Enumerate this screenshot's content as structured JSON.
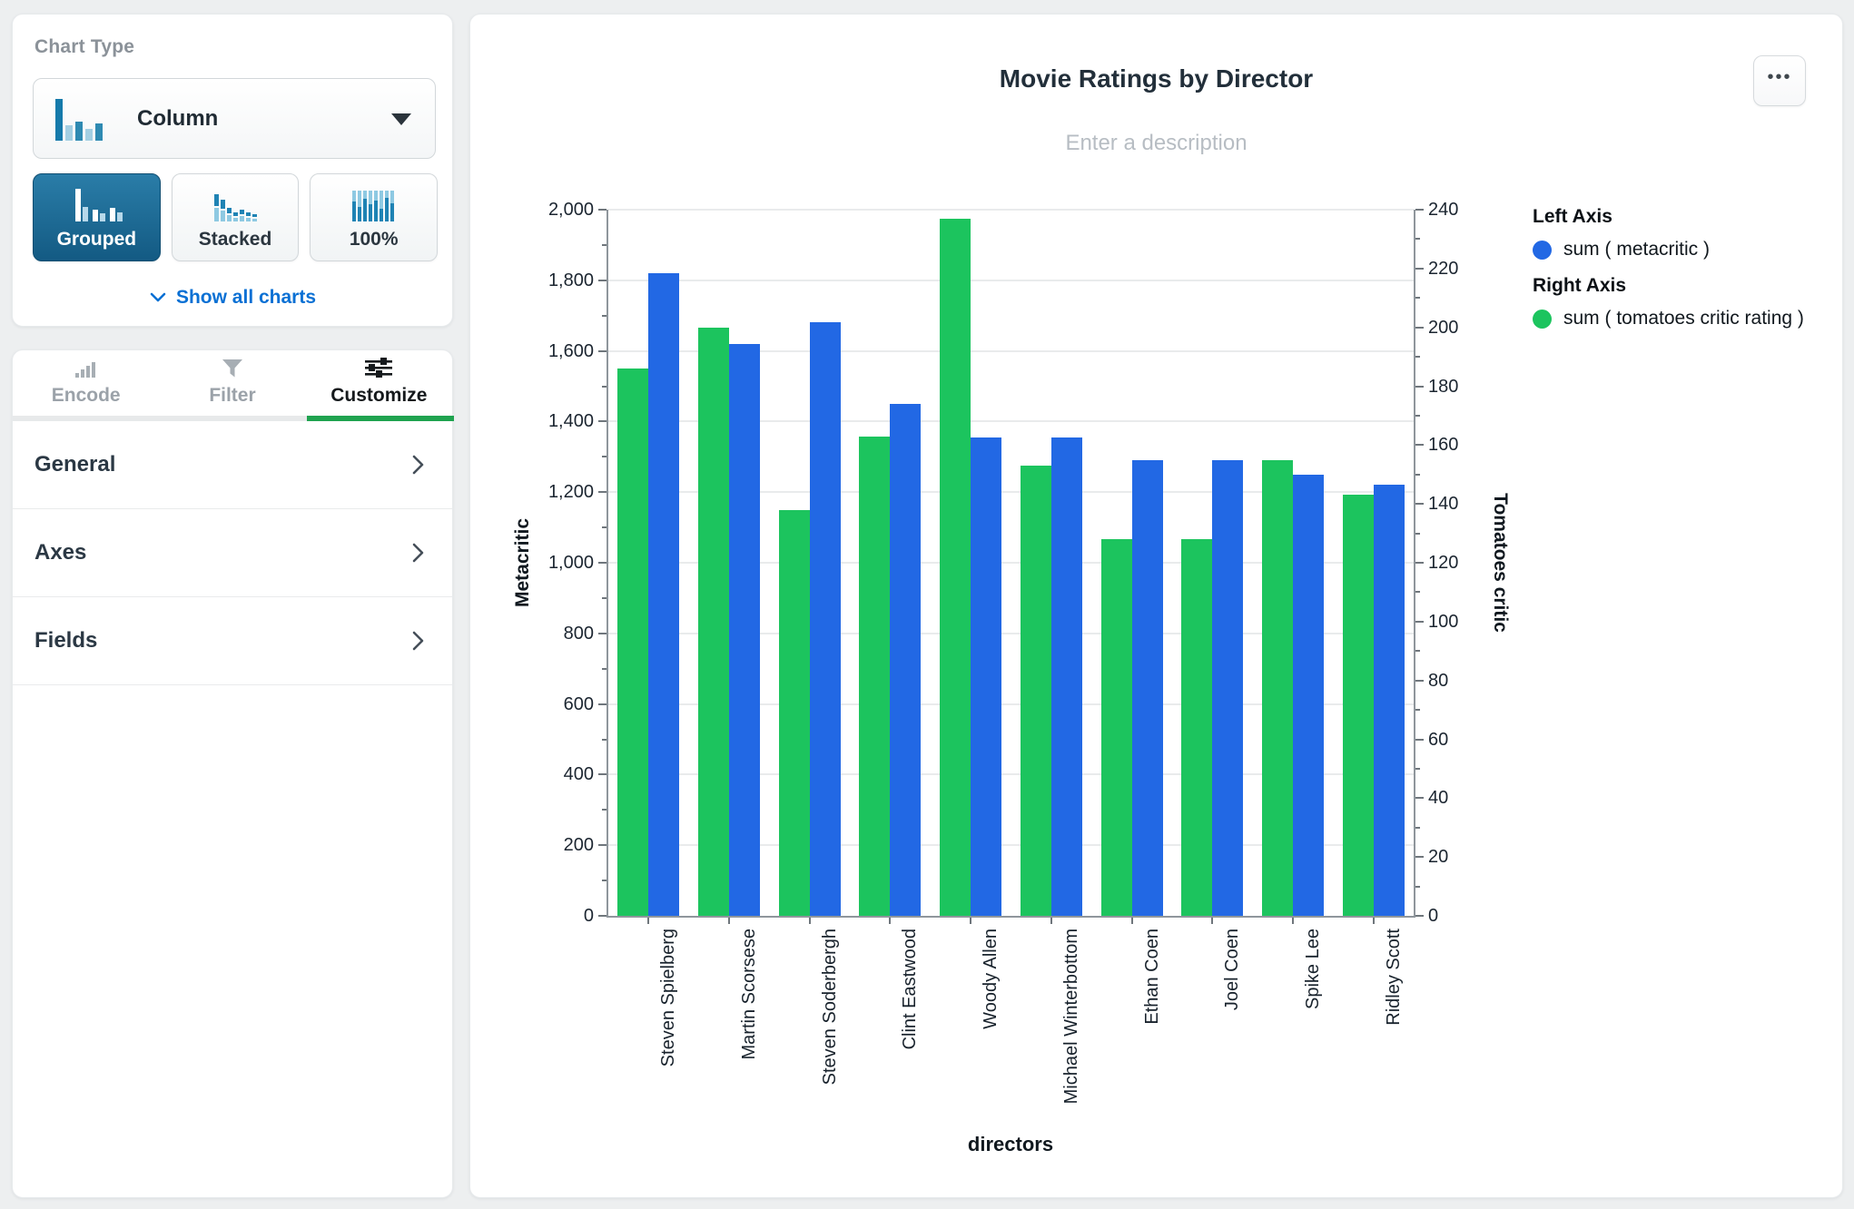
{
  "sidebar": {
    "chart_type": {
      "title": "Chart Type",
      "dropdown_value": "Column",
      "variants": [
        {
          "label": "Grouped",
          "active": true
        },
        {
          "label": "Stacked",
          "active": false
        },
        {
          "label": "100%",
          "active": false
        }
      ],
      "show_all_charts": "Show all charts"
    },
    "tabs": [
      {
        "label": "Encode",
        "active": false
      },
      {
        "label": "Filter",
        "active": false
      },
      {
        "label": "Customize",
        "active": true
      }
    ],
    "sections": [
      {
        "label": "General"
      },
      {
        "label": "Axes"
      },
      {
        "label": "Fields"
      }
    ]
  },
  "chart": {
    "title": "Movie Ratings by Director",
    "description_placeholder": "Enter a description",
    "more_button": "•••"
  },
  "legend": {
    "left_axis_title": "Left Axis",
    "left_axis_item": "sum ( metacritic )",
    "right_axis_title": "Right Axis",
    "right_axis_item": "sum ( tomatoes critic rating )",
    "left_color": "#2268e4",
    "right_color": "#1cc45e"
  },
  "chart_data": {
    "type": "bar",
    "title": "Movie Ratings by Director",
    "xlabel": "directors",
    "categories": [
      "Steven Spielberg",
      "Martin Scorsese",
      "Steven Soderbergh",
      "Clint Eastwood",
      "Woody Allen",
      "Michael Winterbottom",
      "Ethan Coen",
      "Joel Coen",
      "Spike Lee",
      "Ridley Scott"
    ],
    "series": [
      {
        "name": "sum ( metacritic )",
        "axis": "left",
        "color": "#2268e4",
        "values": [
          1820,
          1620,
          1680,
          1450,
          1355,
          1355,
          1290,
          1290,
          1250,
          1220
        ]
      },
      {
        "name": "sum ( tomatoes critic rating )",
        "axis": "right",
        "color": "#1cc45e",
        "values": [
          186,
          200,
          138,
          163,
          237,
          153,
          128,
          128,
          155,
          143
        ]
      }
    ],
    "left_axis": {
      "label": "Metacritic",
      "min": 0,
      "max": 2000,
      "tick_step": 200
    },
    "right_axis": {
      "label": "Tomatoes critic",
      "min": 0,
      "max": 240,
      "tick_step": 20
    },
    "grid": true,
    "legend_position": "right",
    "bar_order": [
      "right",
      "left"
    ]
  }
}
